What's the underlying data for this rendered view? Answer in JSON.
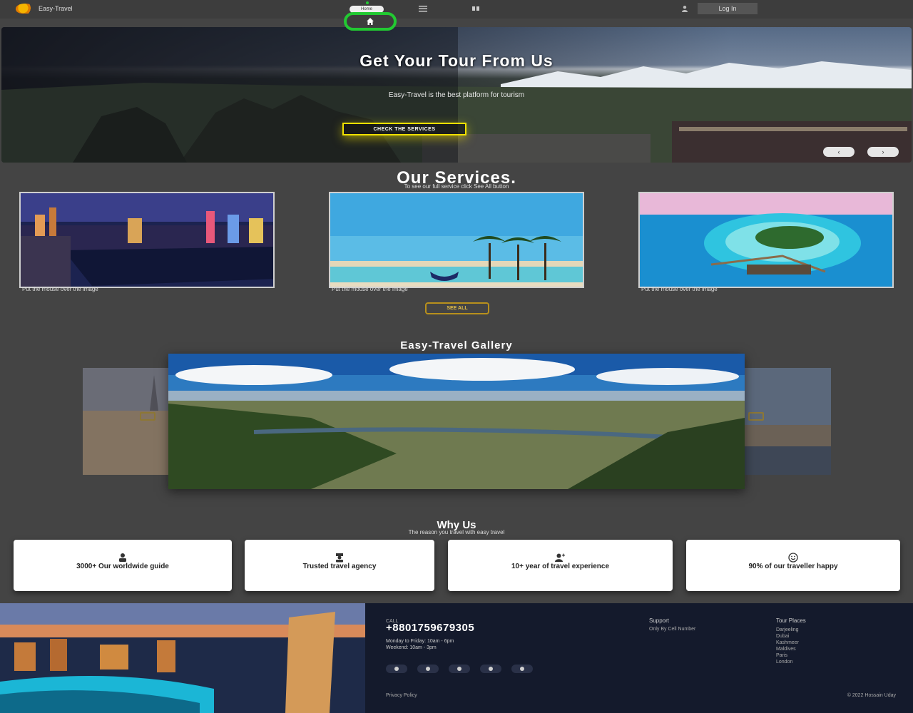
{
  "nav": {
    "brand": "Easy-Travel",
    "home_label": "Home",
    "login_label": "Log In"
  },
  "hero": {
    "title": "Get Your Tour From Us",
    "subtitle": "Easy-Travel is the best platform for tourism",
    "cta_label": "CHECK THE SERVICES",
    "prev_label": "‹",
    "next_label": "›"
  },
  "services": {
    "title": "Our Services.",
    "subtitle": "To see our full service click See All button",
    "cards": [
      {
        "caption": "Put the mouse over the image"
      },
      {
        "caption": "Put the mouse over the image"
      },
      {
        "caption": "Put the mouse over the image"
      }
    ],
    "see_all_label": "SEE ALL"
  },
  "gallery": {
    "title": "Easy-Travel Gallery"
  },
  "why": {
    "title": "Why Us",
    "subtitle": "The reason you travel with easy travel",
    "cards": [
      {
        "icon": "guide-icon",
        "text": "3000+ Our worldwide guide"
      },
      {
        "icon": "agency-icon",
        "text": "Trusted travel agency"
      },
      {
        "icon": "user-plus-icon",
        "text": "10+ year of travel experience"
      },
      {
        "icon": "smile-icon",
        "text": "90% of our traveller happy"
      }
    ]
  },
  "footer": {
    "call_label": "CALL",
    "phone": "+8801759679305",
    "hours_weekday": "Monday to Friday: 10am - 6pm",
    "hours_weekend": "Weekend: 10am - 3pm",
    "support_heading": "Support",
    "support_text": "Only By Cell Number",
    "places_heading": "Tour Places",
    "places": [
      "Darjeeling",
      "Dubai",
      "Kashmeer",
      "Maldives",
      "Paris",
      "London"
    ],
    "privacy": "Privacy Policy",
    "copyright": "© 2022 Hossain Uday"
  },
  "colors": {
    "accent_green": "#22c932",
    "cta_yellow": "#f0e000",
    "gold": "#b8901c",
    "footer_bg": "#141a2c",
    "page_bg": "#444444"
  }
}
